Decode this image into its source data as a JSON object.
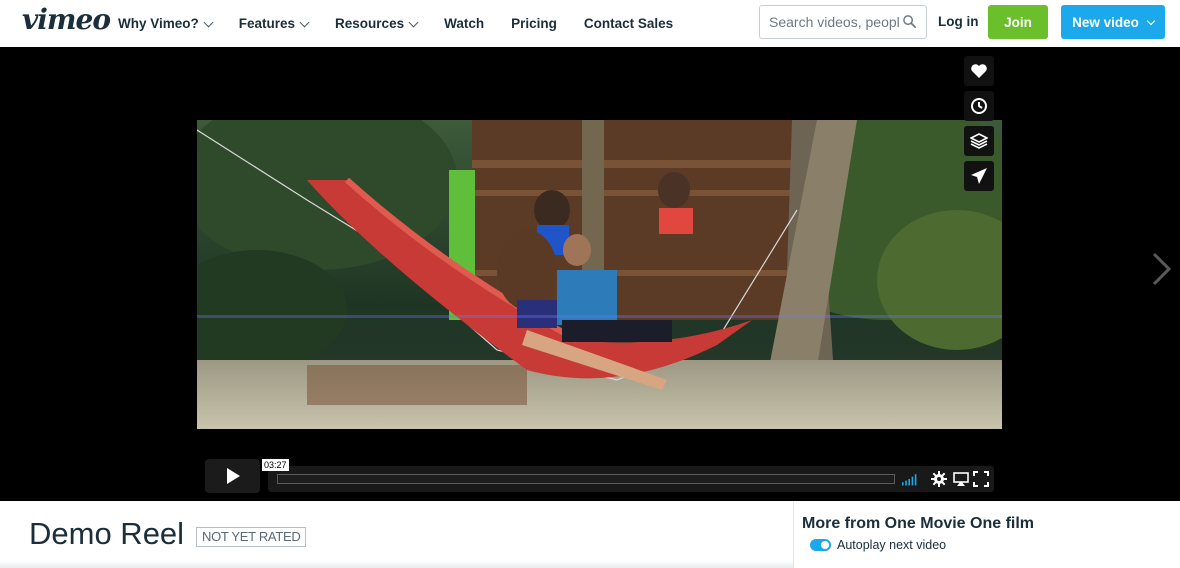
{
  "header": {
    "logo": "vimeo",
    "nav": [
      {
        "label": "Why Vimeo?",
        "has_dropdown": true
      },
      {
        "label": "Features",
        "has_dropdown": true
      },
      {
        "label": "Resources",
        "has_dropdown": true
      },
      {
        "label": "Watch",
        "has_dropdown": false
      },
      {
        "label": "Pricing",
        "has_dropdown": false
      },
      {
        "label": "Contact Sales",
        "has_dropdown": false
      }
    ],
    "search_placeholder": "Search videos, people...",
    "login_label": "Log in",
    "join_label": "Join",
    "new_video_label": "New video"
  },
  "player": {
    "side_actions": [
      "heart-icon",
      "clock-icon",
      "layers-icon",
      "send-icon"
    ],
    "time": "03:27",
    "progress": 0,
    "controls": [
      "volume-bars-icon",
      "settings-icon",
      "airplay-icon",
      "fullscreen-icon"
    ]
  },
  "video_info": {
    "title": "Demo Reel",
    "rating": "NOT YET RATED"
  },
  "sidebar": {
    "title": "More from One Movie One film",
    "autoplay_label": "Autoplay next video",
    "autoplay_enabled": true
  },
  "colors": {
    "brand_text": "#1a2e3b",
    "join": "#6bbf2b",
    "new_video": "#1ba9ec",
    "toggle_on": "#1ba9ec"
  }
}
